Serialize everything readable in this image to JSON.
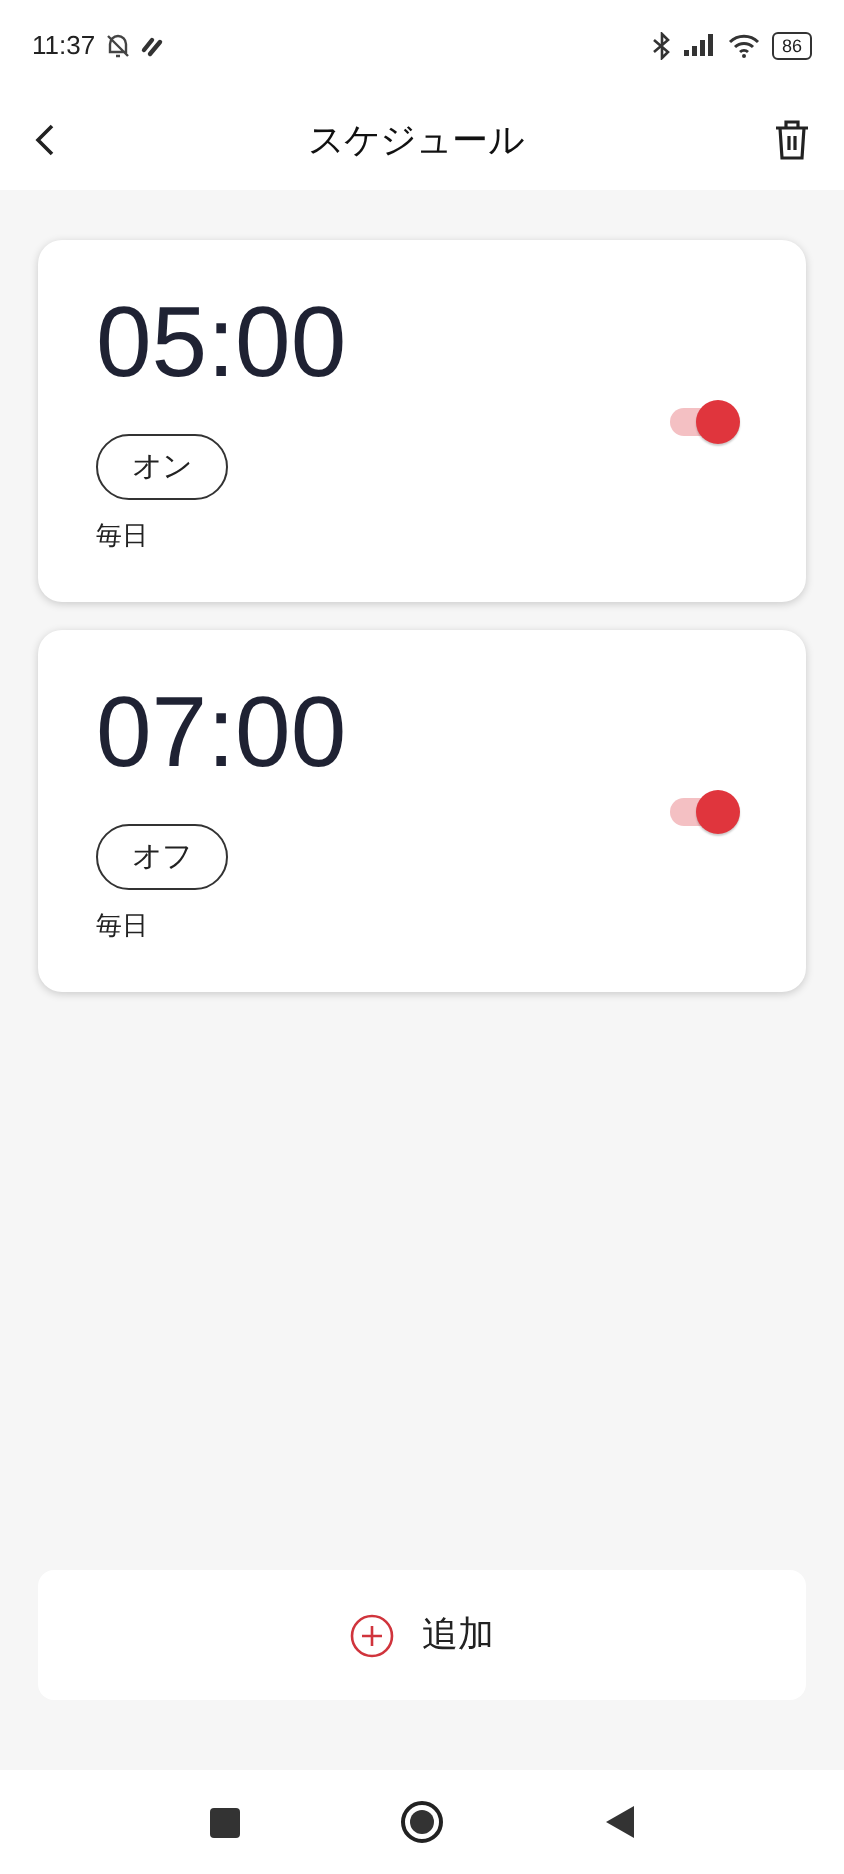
{
  "status_bar": {
    "time": "11:37",
    "battery": "86"
  },
  "header": {
    "title": "スケジュール"
  },
  "schedules": [
    {
      "time": "05:00",
      "tag": "オン",
      "repeat": "毎日",
      "on": true
    },
    {
      "time": "07:00",
      "tag": "オフ",
      "repeat": "毎日",
      "on": true
    }
  ],
  "add_button": {
    "label": "追加"
  }
}
